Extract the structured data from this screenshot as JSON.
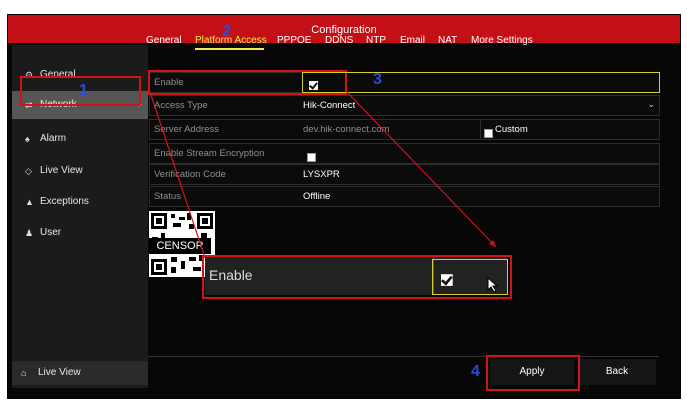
{
  "title": "Configuration",
  "sidebar": {
    "items": [
      {
        "label": "General",
        "icon": "gear-icon"
      },
      {
        "label": "Network",
        "icon": "network-icon"
      },
      {
        "label": "Alarm",
        "icon": "alarm-icon"
      },
      {
        "label": "Live View",
        "icon": "live-view-icon"
      },
      {
        "label": "Exceptions",
        "icon": "warning-icon"
      },
      {
        "label": "User",
        "icon": "user-icon"
      }
    ],
    "active": "Network",
    "chevron": "›",
    "bottom_label": "Live View"
  },
  "tabs": [
    "General",
    "Platform Access",
    "PPPOE",
    "DDNS",
    "NTP",
    "Email",
    "NAT",
    "More Settings"
  ],
  "active_tab": "Platform Access",
  "form": {
    "enable": {
      "label": "Enable",
      "checked": true
    },
    "access_type": {
      "label": "Access Type",
      "value": "Hik-Connect"
    },
    "server_address": {
      "label": "Server Address",
      "value": "dev.hik-connect.com",
      "custom_label": "Custom"
    },
    "stream_encryption": {
      "label": "Enable Stream Encryption"
    },
    "verification_code": {
      "label": "Verification Code",
      "value": "LYSXPR"
    },
    "status": {
      "label": "Status",
      "value": "Offline"
    }
  },
  "censor_text": "CENSOR",
  "zoom_label": "Enable",
  "buttons": {
    "apply": "Apply",
    "back": "Back"
  },
  "annotations": {
    "n1": "1",
    "n2": "2",
    "n3": "3",
    "n4": "4"
  },
  "colors": {
    "title_bar": "#c21016",
    "active_tab": "#f2e84a",
    "annotation_red": "#d5121a",
    "annotation_blue": "#2a4bd8"
  }
}
